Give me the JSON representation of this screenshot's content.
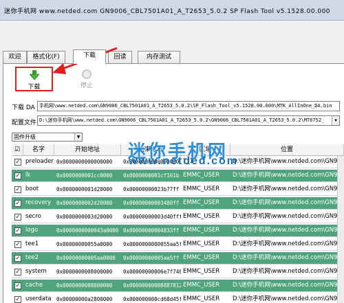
{
  "window": {
    "title": "迷你手机网 www.netded.com GN9006_CBL7501A01_A_T2653_5.0.2 SP Flash Tool v5.1528.00.000"
  },
  "tabs": [
    {
      "label": "欢迎"
    },
    {
      "label": "格式化(F)"
    },
    {
      "label": "下载"
    },
    {
      "label": "回读"
    },
    {
      "label": "内存测试"
    }
  ],
  "toolbar": {
    "download_label": "下载",
    "stop_label": "停止"
  },
  "download_agent": {
    "label": "下载 DA",
    "value": "手机网\\www.netded.com\\GN9006_CBL7501A01_A_T2653_5.0.2\\SP_Flash_Tool_v5.1528.00.000\\MTK_AllInOne_DA.bin"
  },
  "scatter": {
    "label": "配置文件",
    "value": "D:\\迷你手机网\\www.netded.com\\GN9006_CBL7501A01_A_T2653_5.0.2\\GN9006_CBL7501A01_A_T2653_5.0.2\\MT6752_"
  },
  "mode": {
    "value": "固件升级"
  },
  "table": {
    "headers": {
      "check": "☑",
      "name": "名字",
      "begin": "开始地址",
      "end": "结束地址",
      "region": "区域",
      "location": "位置"
    },
    "rows": [
      {
        "checked": true,
        "name": "preloader",
        "begin": "0x0000000000000000",
        "end": "0x0000000000000000",
        "region": "T_1",
        "location": "D:\\迷你手机网\\www.netded.com\\GN9006"
      },
      {
        "checked": true,
        "name": "lk",
        "begin": "0x0000000001cc0000",
        "end": "0x0000000001cf161b",
        "region": "EMMC_USER",
        "location": "D:\\迷你手机网\\www.netded.com\\GN9006"
      },
      {
        "checked": true,
        "name": "boot",
        "begin": "0x0000000001d20000",
        "end": "0x00000000023b77ff",
        "region": "EMMC_USER",
        "location": "D:\\迷你手机网\\www.netded.com\\GN9006"
      },
      {
        "checked": true,
        "name": "recovery",
        "begin": "0x0000000002d20000",
        "end": "0x00000000003480ff",
        "region": "EMMC_USER",
        "location": "D:\\迷你手机网\\www.netded.com\\GN9006"
      },
      {
        "checked": true,
        "name": "secro",
        "begin": "0x0000000003d20000",
        "end": "0x00000000003d40fff",
        "region": "EMMC_USER",
        "location": "D:\\迷你手机网\\www.netded.com\\GN9006"
      },
      {
        "checked": true,
        "name": "logo",
        "begin": "0x0000000000043a0000",
        "end": "0x00000000004833ff",
        "region": "EMMC_USER",
        "location": "D:\\迷你手机网\\www.netded.com\\GN9006"
      },
      {
        "checked": true,
        "name": "tee1",
        "begin": "0x00000000055a0000",
        "end": "0x0000000000055aa5ff",
        "region": "EMMC_USER",
        "location": "D:\\迷你手机网\\www.netded.com\\GN9006"
      },
      {
        "checked": true,
        "name": "tee2",
        "begin": "0x00000000005aa0000",
        "end": "0x00000000005aa5ff",
        "region": "EMMC_USER",
        "location": "D:\\迷你手机网\\www.netded.com\\GN9006"
      },
      {
        "checked": true,
        "name": "system",
        "begin": "0x0000000008000000",
        "end": "0x00000000006e7f7463",
        "region": "EMMC_USER",
        "location": "D:\\迷你手机网\\www.netded.com\\GN9006"
      },
      {
        "checked": true,
        "name": "cache",
        "begin": "0x0000000088000000",
        "end": "0x00000000008887812f",
        "region": "EMMC_USER",
        "location": "D:\\迷你手机网\\www.netded.com\\GN9006"
      },
      {
        "checked": true,
        "name": "userdata",
        "begin": "0x00000000a2800000",
        "end": "0x000000000cd68d45f",
        "region": "EMMC_USER",
        "location": "D:\\迷你手机网\\www.netded.com\\GN9006"
      }
    ]
  },
  "watermark": {
    "title": "迷你手机网",
    "url": "www.netded.com"
  },
  "colors": {
    "row_highlight": "#4fa47d",
    "annotation": "#e02020",
    "watermark": "#2d8fd8"
  }
}
